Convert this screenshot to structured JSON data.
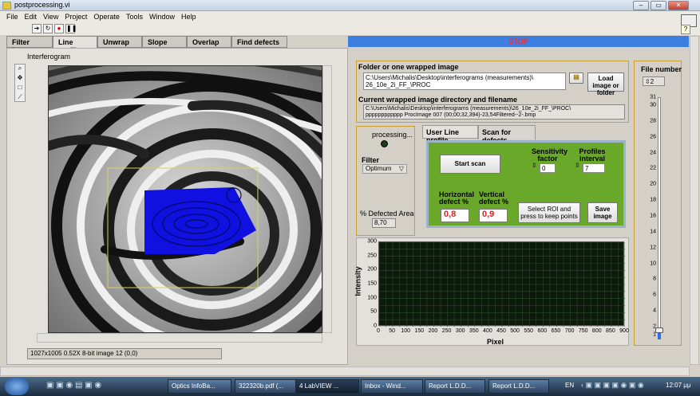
{
  "window": {
    "title": "postprocessing.vi"
  },
  "menu": [
    "File",
    "Edit",
    "View",
    "Project",
    "Operate",
    "Tools",
    "Window",
    "Help"
  ],
  "tabs": [
    "Filter image",
    "Line profile",
    "Unwrap",
    "Slope",
    "Overlap",
    "Find defects"
  ],
  "stop_label": "STOP",
  "image": {
    "label": "Interferogram",
    "status": "1027x1005 0.52X 8-bit image 12   (0,0)"
  },
  "folder": {
    "label": "Folder or one wrapped image",
    "path_line1": "C:\\Users\\Michalis\\Desktop\\interferograms (measurements)\\",
    "path_line2": "26_10e_2i_FF_\\PROC",
    "load_button": "Load image or folder"
  },
  "current": {
    "label": "Current wrapped image directory and filename",
    "line1": "C:\\Users\\Michalis\\Desktop\\interferograms (measurements)\\26_10e_2i_FF_\\PROC\\",
    "line2": "pppppppppppp ProcImage 007 (00;00;32,394)-23,54Filtered--2-.bmp"
  },
  "status_panel": {
    "processing": "processing...",
    "filter_label": "Filter",
    "filter_value": "Optimum",
    "defected_label": "% Defected Area",
    "defected_value": "8,70"
  },
  "subtabs": [
    "User Line profile",
    "Scan for defects"
  ],
  "scan": {
    "start": "Start scan",
    "sensitivity_label": "Sensitivity factor",
    "sensitivity_value": "0",
    "profiles_label": "Profiles interval",
    "profiles_value": "7",
    "h_label": "Horizontal defect %",
    "h_value": "0,8",
    "v_label": "Vertical defect %",
    "v_value": "0,9",
    "roi_button": "Select ROI and press to keep points",
    "save_button": "Save image"
  },
  "file_number": {
    "label": "File number",
    "value": "2",
    "ticks": [
      "31",
      "30",
      "28",
      "26",
      "24",
      "22",
      "20",
      "18",
      "16",
      "14",
      "12",
      "10",
      "8",
      "6",
      "4",
      "2",
      "1"
    ]
  },
  "chart_data": {
    "type": "line",
    "xlabel": "Pixel",
    "ylabel": "Intensity",
    "xlim": [
      0,
      900
    ],
    "ylim": [
      0,
      300
    ],
    "x_ticks": [
      "0",
      "50",
      "100",
      "150",
      "200",
      "250",
      "300",
      "350",
      "400",
      "450",
      "500",
      "550",
      "600",
      "650",
      "700",
      "750",
      "800",
      "850",
      "900"
    ],
    "y_ticks": [
      "300",
      "250",
      "200",
      "150",
      "100",
      "50",
      "0"
    ]
  },
  "taskbar": [
    "Optics InfoBa...",
    "322320b.pdf (...",
    "4 LabVIEW ...",
    "Inbox - Wind...",
    "Report L.D.D...",
    "Report L.D.D..."
  ],
  "tray": {
    "lang": "EN",
    "time": "12:07 μμ"
  }
}
